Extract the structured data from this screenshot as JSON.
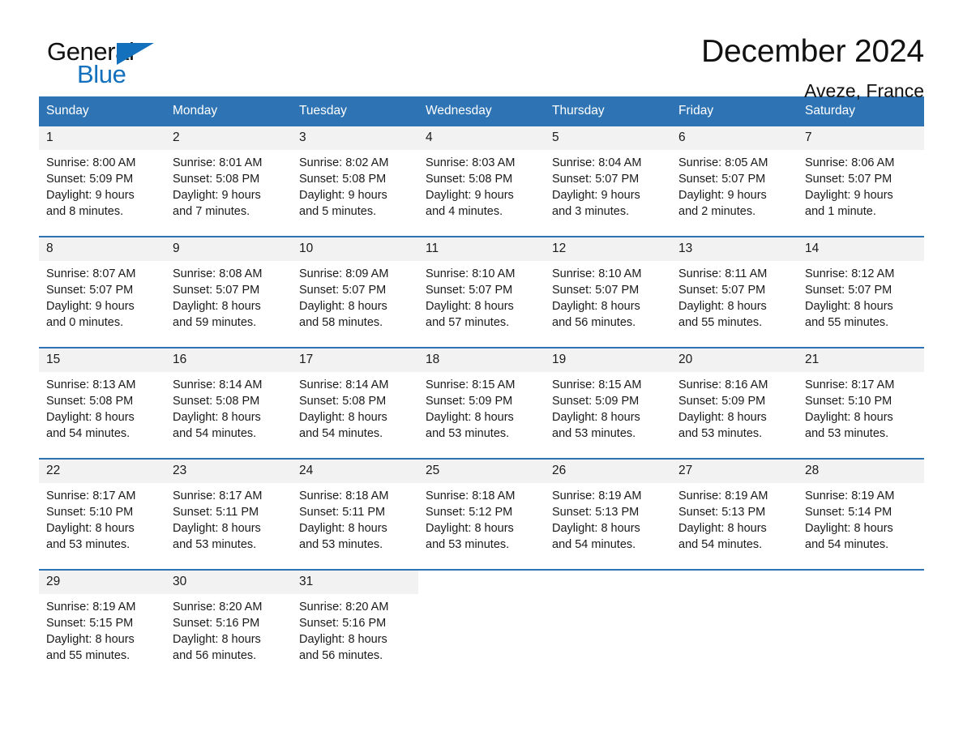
{
  "brand": {
    "name_part1": "General",
    "name_part2": "Blue",
    "accent_color": "#1270bd"
  },
  "header": {
    "title": "December 2024",
    "location": "Aveze, France"
  },
  "theme": {
    "header_bar_color": "#2e74b5",
    "day_band_color": "#f2f2f2",
    "rule_color": "#2e74b5"
  },
  "weekday_headers": [
    "Sunday",
    "Monday",
    "Tuesday",
    "Wednesday",
    "Thursday",
    "Friday",
    "Saturday"
  ],
  "weeks": [
    [
      {
        "day": "1",
        "sunrise": "Sunrise: 8:00 AM",
        "sunset": "Sunset: 5:09 PM",
        "daylight_line1": "Daylight: 9 hours",
        "daylight_line2": "and 8 minutes."
      },
      {
        "day": "2",
        "sunrise": "Sunrise: 8:01 AM",
        "sunset": "Sunset: 5:08 PM",
        "daylight_line1": "Daylight: 9 hours",
        "daylight_line2": "and 7 minutes."
      },
      {
        "day": "3",
        "sunrise": "Sunrise: 8:02 AM",
        "sunset": "Sunset: 5:08 PM",
        "daylight_line1": "Daylight: 9 hours",
        "daylight_line2": "and 5 minutes."
      },
      {
        "day": "4",
        "sunrise": "Sunrise: 8:03 AM",
        "sunset": "Sunset: 5:08 PM",
        "daylight_line1": "Daylight: 9 hours",
        "daylight_line2": "and 4 minutes."
      },
      {
        "day": "5",
        "sunrise": "Sunrise: 8:04 AM",
        "sunset": "Sunset: 5:07 PM",
        "daylight_line1": "Daylight: 9 hours",
        "daylight_line2": "and 3 minutes."
      },
      {
        "day": "6",
        "sunrise": "Sunrise: 8:05 AM",
        "sunset": "Sunset: 5:07 PM",
        "daylight_line1": "Daylight: 9 hours",
        "daylight_line2": "and 2 minutes."
      },
      {
        "day": "7",
        "sunrise": "Sunrise: 8:06 AM",
        "sunset": "Sunset: 5:07 PM",
        "daylight_line1": "Daylight: 9 hours",
        "daylight_line2": "and 1 minute."
      }
    ],
    [
      {
        "day": "8",
        "sunrise": "Sunrise: 8:07 AM",
        "sunset": "Sunset: 5:07 PM",
        "daylight_line1": "Daylight: 9 hours",
        "daylight_line2": "and 0 minutes."
      },
      {
        "day": "9",
        "sunrise": "Sunrise: 8:08 AM",
        "sunset": "Sunset: 5:07 PM",
        "daylight_line1": "Daylight: 8 hours",
        "daylight_line2": "and 59 minutes."
      },
      {
        "day": "10",
        "sunrise": "Sunrise: 8:09 AM",
        "sunset": "Sunset: 5:07 PM",
        "daylight_line1": "Daylight: 8 hours",
        "daylight_line2": "and 58 minutes."
      },
      {
        "day": "11",
        "sunrise": "Sunrise: 8:10 AM",
        "sunset": "Sunset: 5:07 PM",
        "daylight_line1": "Daylight: 8 hours",
        "daylight_line2": "and 57 minutes."
      },
      {
        "day": "12",
        "sunrise": "Sunrise: 8:10 AM",
        "sunset": "Sunset: 5:07 PM",
        "daylight_line1": "Daylight: 8 hours",
        "daylight_line2": "and 56 minutes."
      },
      {
        "day": "13",
        "sunrise": "Sunrise: 8:11 AM",
        "sunset": "Sunset: 5:07 PM",
        "daylight_line1": "Daylight: 8 hours",
        "daylight_line2": "and 55 minutes."
      },
      {
        "day": "14",
        "sunrise": "Sunrise: 8:12 AM",
        "sunset": "Sunset: 5:07 PM",
        "daylight_line1": "Daylight: 8 hours",
        "daylight_line2": "and 55 minutes."
      }
    ],
    [
      {
        "day": "15",
        "sunrise": "Sunrise: 8:13 AM",
        "sunset": "Sunset: 5:08 PM",
        "daylight_line1": "Daylight: 8 hours",
        "daylight_line2": "and 54 minutes."
      },
      {
        "day": "16",
        "sunrise": "Sunrise: 8:14 AM",
        "sunset": "Sunset: 5:08 PM",
        "daylight_line1": "Daylight: 8 hours",
        "daylight_line2": "and 54 minutes."
      },
      {
        "day": "17",
        "sunrise": "Sunrise: 8:14 AM",
        "sunset": "Sunset: 5:08 PM",
        "daylight_line1": "Daylight: 8 hours",
        "daylight_line2": "and 54 minutes."
      },
      {
        "day": "18",
        "sunrise": "Sunrise: 8:15 AM",
        "sunset": "Sunset: 5:09 PM",
        "daylight_line1": "Daylight: 8 hours",
        "daylight_line2": "and 53 minutes."
      },
      {
        "day": "19",
        "sunrise": "Sunrise: 8:15 AM",
        "sunset": "Sunset: 5:09 PM",
        "daylight_line1": "Daylight: 8 hours",
        "daylight_line2": "and 53 minutes."
      },
      {
        "day": "20",
        "sunrise": "Sunrise: 8:16 AM",
        "sunset": "Sunset: 5:09 PM",
        "daylight_line1": "Daylight: 8 hours",
        "daylight_line2": "and 53 minutes."
      },
      {
        "day": "21",
        "sunrise": "Sunrise: 8:17 AM",
        "sunset": "Sunset: 5:10 PM",
        "daylight_line1": "Daylight: 8 hours",
        "daylight_line2": "and 53 minutes."
      }
    ],
    [
      {
        "day": "22",
        "sunrise": "Sunrise: 8:17 AM",
        "sunset": "Sunset: 5:10 PM",
        "daylight_line1": "Daylight: 8 hours",
        "daylight_line2": "and 53 minutes."
      },
      {
        "day": "23",
        "sunrise": "Sunrise: 8:17 AM",
        "sunset": "Sunset: 5:11 PM",
        "daylight_line1": "Daylight: 8 hours",
        "daylight_line2": "and 53 minutes."
      },
      {
        "day": "24",
        "sunrise": "Sunrise: 8:18 AM",
        "sunset": "Sunset: 5:11 PM",
        "daylight_line1": "Daylight: 8 hours",
        "daylight_line2": "and 53 minutes."
      },
      {
        "day": "25",
        "sunrise": "Sunrise: 8:18 AM",
        "sunset": "Sunset: 5:12 PM",
        "daylight_line1": "Daylight: 8 hours",
        "daylight_line2": "and 53 minutes."
      },
      {
        "day": "26",
        "sunrise": "Sunrise: 8:19 AM",
        "sunset": "Sunset: 5:13 PM",
        "daylight_line1": "Daylight: 8 hours",
        "daylight_line2": "and 54 minutes."
      },
      {
        "day": "27",
        "sunrise": "Sunrise: 8:19 AM",
        "sunset": "Sunset: 5:13 PM",
        "daylight_line1": "Daylight: 8 hours",
        "daylight_line2": "and 54 minutes."
      },
      {
        "day": "28",
        "sunrise": "Sunrise: 8:19 AM",
        "sunset": "Sunset: 5:14 PM",
        "daylight_line1": "Daylight: 8 hours",
        "daylight_line2": "and 54 minutes."
      }
    ],
    [
      {
        "day": "29",
        "sunrise": "Sunrise: 8:19 AM",
        "sunset": "Sunset: 5:15 PM",
        "daylight_line1": "Daylight: 8 hours",
        "daylight_line2": "and 55 minutes."
      },
      {
        "day": "30",
        "sunrise": "Sunrise: 8:20 AM",
        "sunset": "Sunset: 5:16 PM",
        "daylight_line1": "Daylight: 8 hours",
        "daylight_line2": "and 56 minutes."
      },
      {
        "day": "31",
        "sunrise": "Sunrise: 8:20 AM",
        "sunset": "Sunset: 5:16 PM",
        "daylight_line1": "Daylight: 8 hours",
        "daylight_line2": "and 56 minutes."
      },
      {
        "day": "",
        "sunrise": "",
        "sunset": "",
        "daylight_line1": "",
        "daylight_line2": ""
      },
      {
        "day": "",
        "sunrise": "",
        "sunset": "",
        "daylight_line1": "",
        "daylight_line2": ""
      },
      {
        "day": "",
        "sunrise": "",
        "sunset": "",
        "daylight_line1": "",
        "daylight_line2": ""
      },
      {
        "day": "",
        "sunrise": "",
        "sunset": "",
        "daylight_line1": "",
        "daylight_line2": ""
      }
    ]
  ]
}
